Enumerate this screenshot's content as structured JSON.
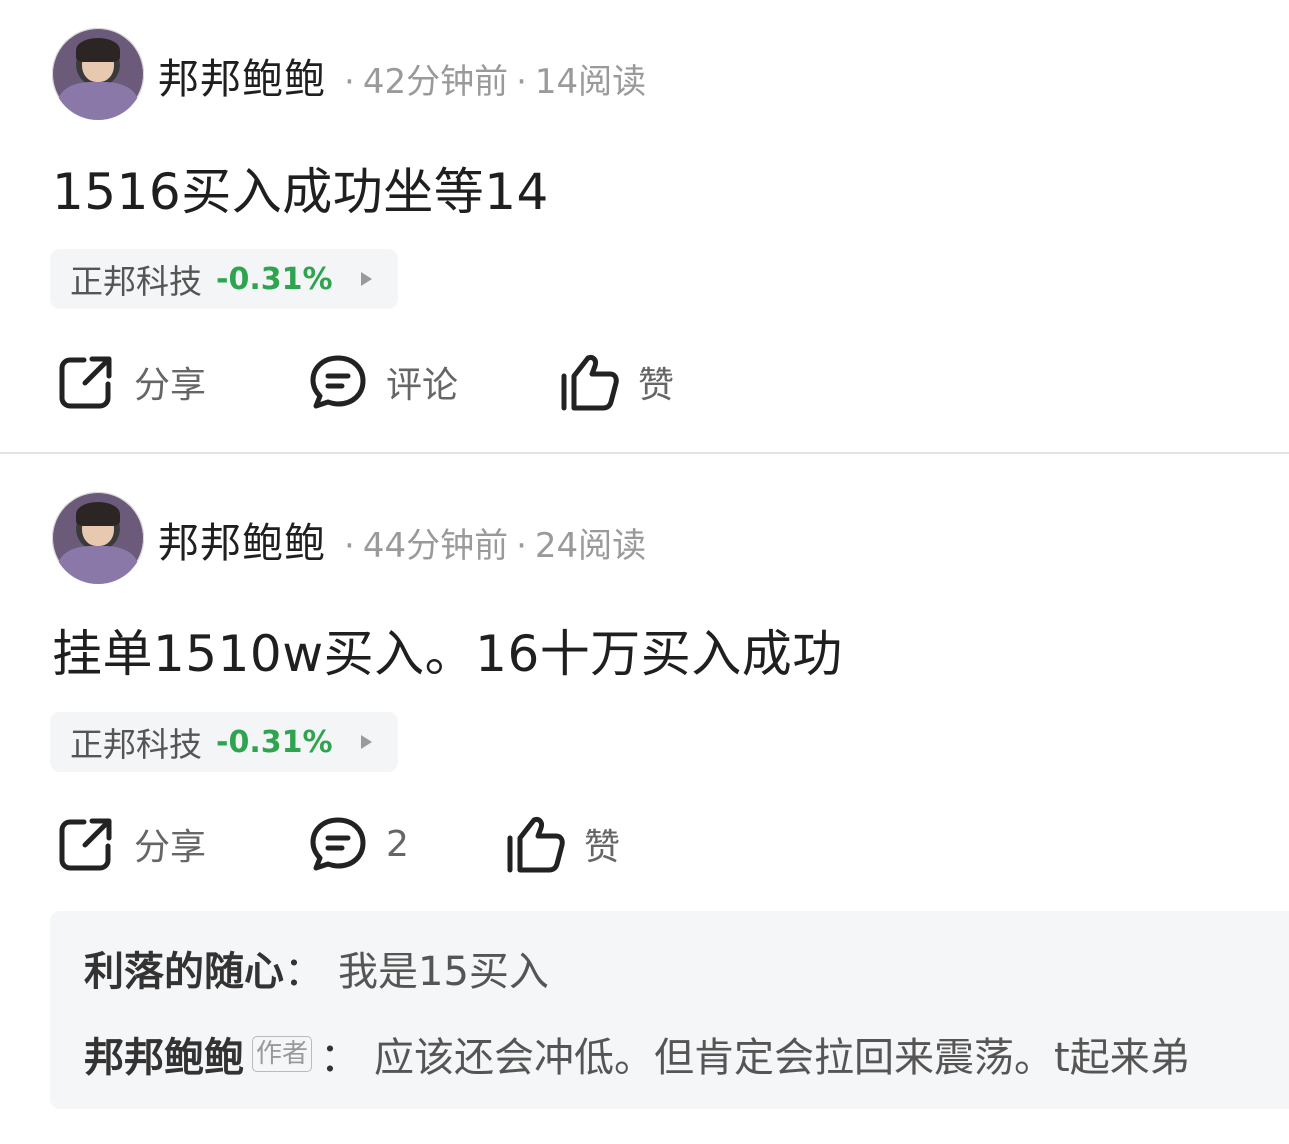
{
  "posts": [
    {
      "author": "邦邦鲍鲍",
      "time": "42分钟前",
      "reads": "14阅读",
      "content": "1516买入成功坐等14",
      "stock": {
        "name": "正邦科技",
        "change": "-0.31%"
      },
      "actions": {
        "share": "分享",
        "comment": "评论",
        "like": "赞"
      }
    },
    {
      "author": "邦邦鲍鲍",
      "time": "44分钟前",
      "reads": "24阅读",
      "content": "挂单1510w买入。16十万买入成功",
      "stock": {
        "name": "正邦科技",
        "change": "-0.31%"
      },
      "actions": {
        "share": "分享",
        "comment": "2",
        "like": "赞"
      },
      "comments": [
        {
          "author": "利落的随心",
          "colon": "：",
          "text": "我是15买入"
        },
        {
          "author": "邦邦鲍鲍",
          "badge": "作者",
          "colon": "：",
          "text": "应该还会冲低。但肯定会拉回来震荡。t起来弟"
        }
      ]
    }
  ],
  "meta_separator": "·",
  "colors": {
    "change_down": "#2ea44f",
    "meta_gray": "#9a9a9a",
    "tag_bg": "#f4f5f7"
  }
}
